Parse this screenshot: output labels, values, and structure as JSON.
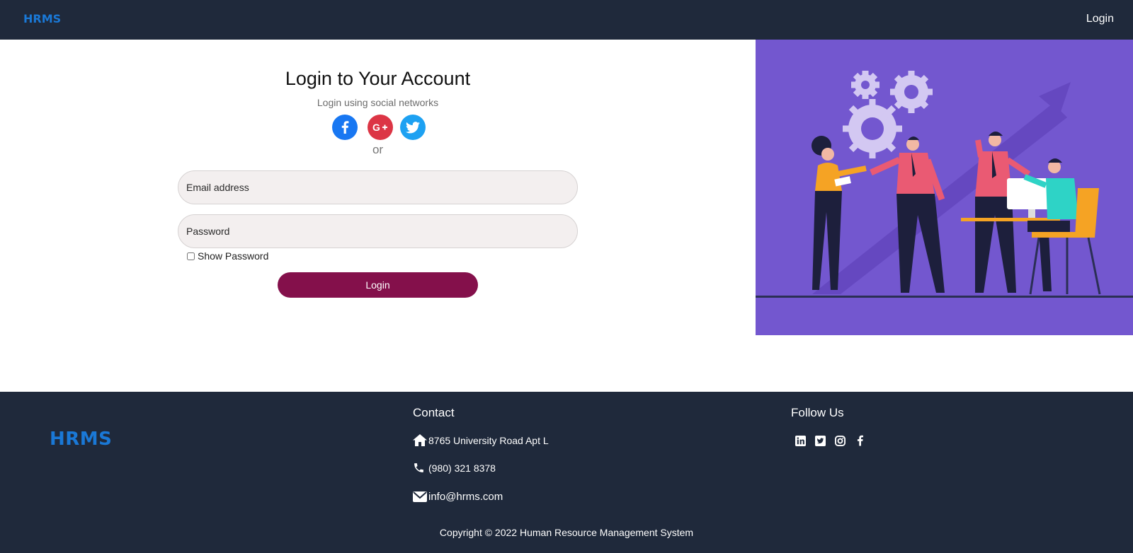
{
  "navbar": {
    "brand": "HRMS",
    "login_link": "Login"
  },
  "login": {
    "title": "Login to Your Account",
    "subtitle": "Login using social networks",
    "social": [
      {
        "name": "facebook-icon",
        "color": "#1877f2"
      },
      {
        "name": "google-plus-icon",
        "color": "#dc3545"
      },
      {
        "name": "twitter-icon",
        "color": "#1da1f2"
      }
    ],
    "or_text": "or",
    "email_placeholder": "Email address",
    "email_value": "",
    "password_placeholder": "Password",
    "password_value": "",
    "show_password_label": "Show Password",
    "show_password_checked": false,
    "submit_label": "Login",
    "submit_color": "#84104b"
  },
  "illustration": {
    "background": "#7357cf",
    "icon": "team-meeting-illustration"
  },
  "footer": {
    "brand": "HRMS",
    "contact_heading": "Contact",
    "address": "8765 University Road Apt L",
    "phone": "(980) 321 8378",
    "email": "info@hrms.com",
    "follow_heading": "Follow Us",
    "social_icons": [
      "linkedin-icon",
      "twitter-icon",
      "instagram-icon",
      "facebook-icon"
    ],
    "copyright": "Copyright © 2022 Human Resource Management System"
  },
  "colors": {
    "nav_bg": "#1f293b",
    "brand": "#1a78d6"
  }
}
